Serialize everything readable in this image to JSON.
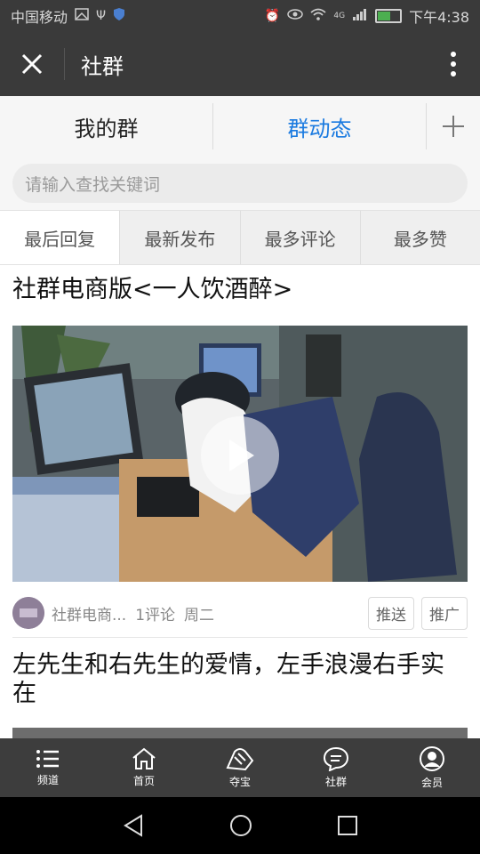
{
  "status_bar": {
    "carrier": "中国移动",
    "time": "下午4:38",
    "network": "4G"
  },
  "top_bar": {
    "title": "社群"
  },
  "tabs": [
    {
      "label": "我的群"
    },
    {
      "label": "群动态"
    }
  ],
  "search": {
    "placeholder": "请输入查找关键词"
  },
  "sort_tabs": [
    {
      "label": "最后回复"
    },
    {
      "label": "最新发布"
    },
    {
      "label": "最多评论"
    },
    {
      "label": "最多赞"
    }
  ],
  "posts": [
    {
      "title": "社群电商版<一人饮酒醉>",
      "author": "社群电商...",
      "comments": "1评论",
      "day": "周二",
      "push_label": "推送",
      "promote_label": "推广"
    },
    {
      "title": "左先生和右先生的爱情，左手浪漫右手实在"
    }
  ],
  "bottom_nav": [
    {
      "label": "频道",
      "icon": "list-icon"
    },
    {
      "label": "首页",
      "icon": "home-icon"
    },
    {
      "label": "夺宝",
      "icon": "treasure-icon"
    },
    {
      "label": "社群",
      "icon": "chat-icon"
    },
    {
      "label": "会员",
      "icon": "user-icon"
    }
  ],
  "colors": {
    "accent": "#1a7ae0",
    "header_bg": "#3a3a3a",
    "nav_bg": "#3d3d3d"
  }
}
